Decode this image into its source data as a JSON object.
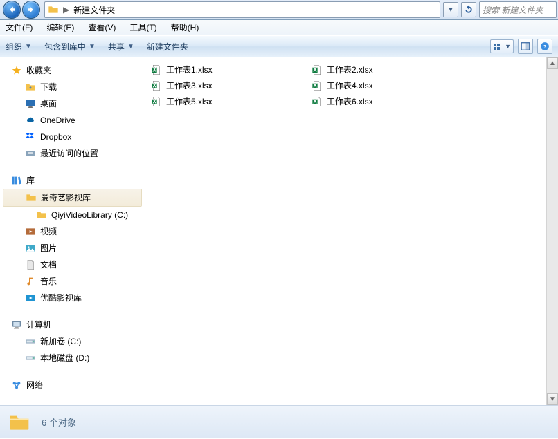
{
  "address": {
    "crumb": "新建文件夹",
    "refresh_tip": "refresh",
    "search_placeholder": "搜索 新建文件夹"
  },
  "menu": {
    "file": "文件(F)",
    "edit": "编辑(E)",
    "view": "查看(V)",
    "tools": "工具(T)",
    "help": "帮助(H)"
  },
  "commands": {
    "organize": "组织",
    "include": "包含到库中",
    "share": "共享",
    "newfolder": "新建文件夹"
  },
  "sidebar": {
    "favorites": {
      "label": "收藏夹",
      "items": [
        {
          "label": "下载"
        },
        {
          "label": "桌面"
        },
        {
          "label": "OneDrive"
        },
        {
          "label": "Dropbox"
        },
        {
          "label": "最近访问的位置"
        }
      ]
    },
    "libraries": {
      "label": "库",
      "items": [
        {
          "label": "爱奇艺影视库",
          "selected": true,
          "children": [
            {
              "label": "QiyiVideoLibrary (C:)"
            }
          ]
        },
        {
          "label": "视频"
        },
        {
          "label": "图片"
        },
        {
          "label": "文档"
        },
        {
          "label": "音乐"
        },
        {
          "label": "优酷影视库"
        }
      ]
    },
    "computer": {
      "label": "计算机",
      "items": [
        {
          "label": "新加卷 (C:)"
        },
        {
          "label": "本地磁盘 (D:)"
        }
      ]
    },
    "network": {
      "label": "网络"
    }
  },
  "files": {
    "col1": [
      "工作表1.xlsx",
      "工作表3.xlsx",
      "工作表5.xlsx"
    ],
    "col2": [
      "工作表2.xlsx",
      "工作表4.xlsx",
      "工作表6.xlsx"
    ]
  },
  "status": {
    "count_text": "6 个对象"
  }
}
